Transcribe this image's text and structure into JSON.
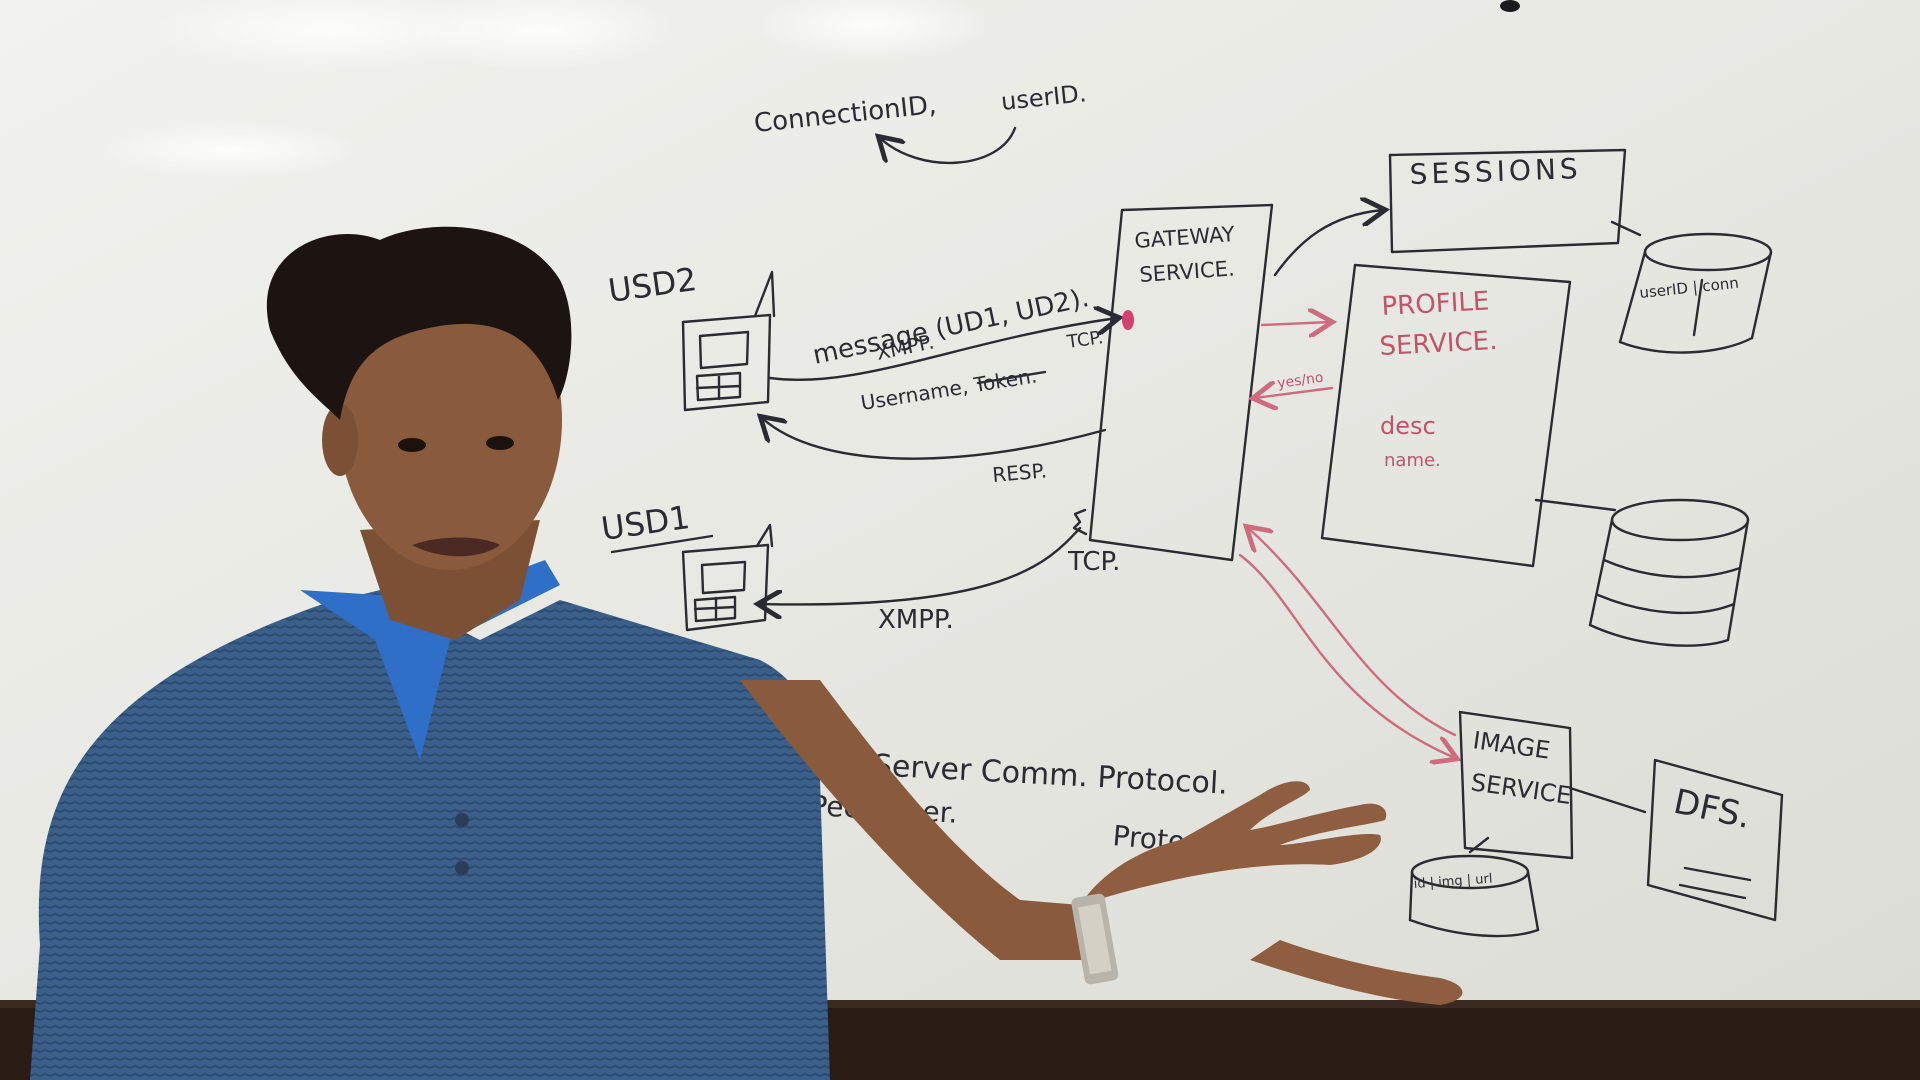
{
  "whiteboard": {
    "connection_note_left": "ConnectionID,",
    "connection_note_right": "userID.",
    "device_top_label": "USD2",
    "device_bottom_label": "USD1",
    "message_label": "message (UD1, UD2).",
    "xmpp_top_label": "XMPP.",
    "tcp_top_label": "TCP.",
    "credentials_label": "Username, Token.",
    "response_label": "RESP.",
    "tcp_bottom_label": "TCP.",
    "xmpp_bottom_label": "XMPP.",
    "gateway_line1": "GATEWAY",
    "gateway_line2": "SERVICE.",
    "sessions_label": "SESSIONS",
    "sessions_db_label": "userID | conn",
    "profile_line1": "PROFILE",
    "profile_line2": "SERVICE.",
    "profile_note1": "desc",
    "profile_note2": "name.",
    "profile_arrow_label": "yes/no",
    "image_line1": "IMAGE",
    "image_line2": "SERVICE",
    "image_db_label": "id | img | url",
    "dfs_label": "DFS.",
    "protocol_line1": "Client-Server Comm. Protocol.",
    "protocol_line2": "Peer- Peer.",
    "protocol_line3": "Protocol."
  },
  "colors": {
    "board": "#ecece8",
    "marker_black": "#2b2b33",
    "marker_red": "#cf6b7d",
    "ledge": "#2a1c14",
    "shirt": "#3a5f8a",
    "collar": "#2f6fc7",
    "skin": "#8a5a3c",
    "hair": "#1c1410"
  }
}
